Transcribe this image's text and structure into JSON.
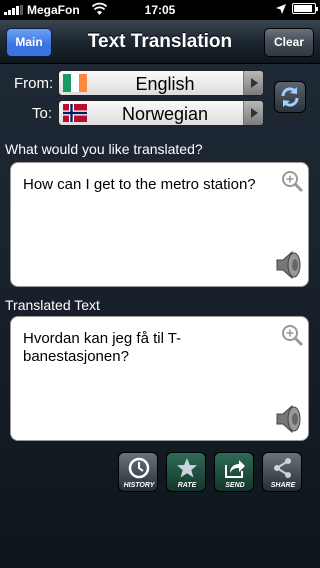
{
  "status_bar": {
    "carrier": "MegaFon",
    "time": "17:05",
    "battery_level": 0.9
  },
  "nav": {
    "title": "Text Translation",
    "main_button": "Main",
    "clear_button": "Clear"
  },
  "languages": {
    "from_label": "From:",
    "to_label": "To:",
    "from_language": "English",
    "to_language": "Norwegian",
    "from_flag": "ireland-flag-icon",
    "to_flag": "norway-flag-icon"
  },
  "source": {
    "prompt": "What would you like translated?",
    "text": "How can I get to the metro station?"
  },
  "result": {
    "label": "Translated Text",
    "text": "Hvordan kan jeg få til T-banestasjonen?"
  },
  "toolbar": {
    "history": "HISTORY",
    "rate": "RATE",
    "send": "SEND",
    "share": "SHARE"
  },
  "colors": {
    "main_button": "#3a74e0",
    "rate_send_buttons": "#2f6b57"
  }
}
